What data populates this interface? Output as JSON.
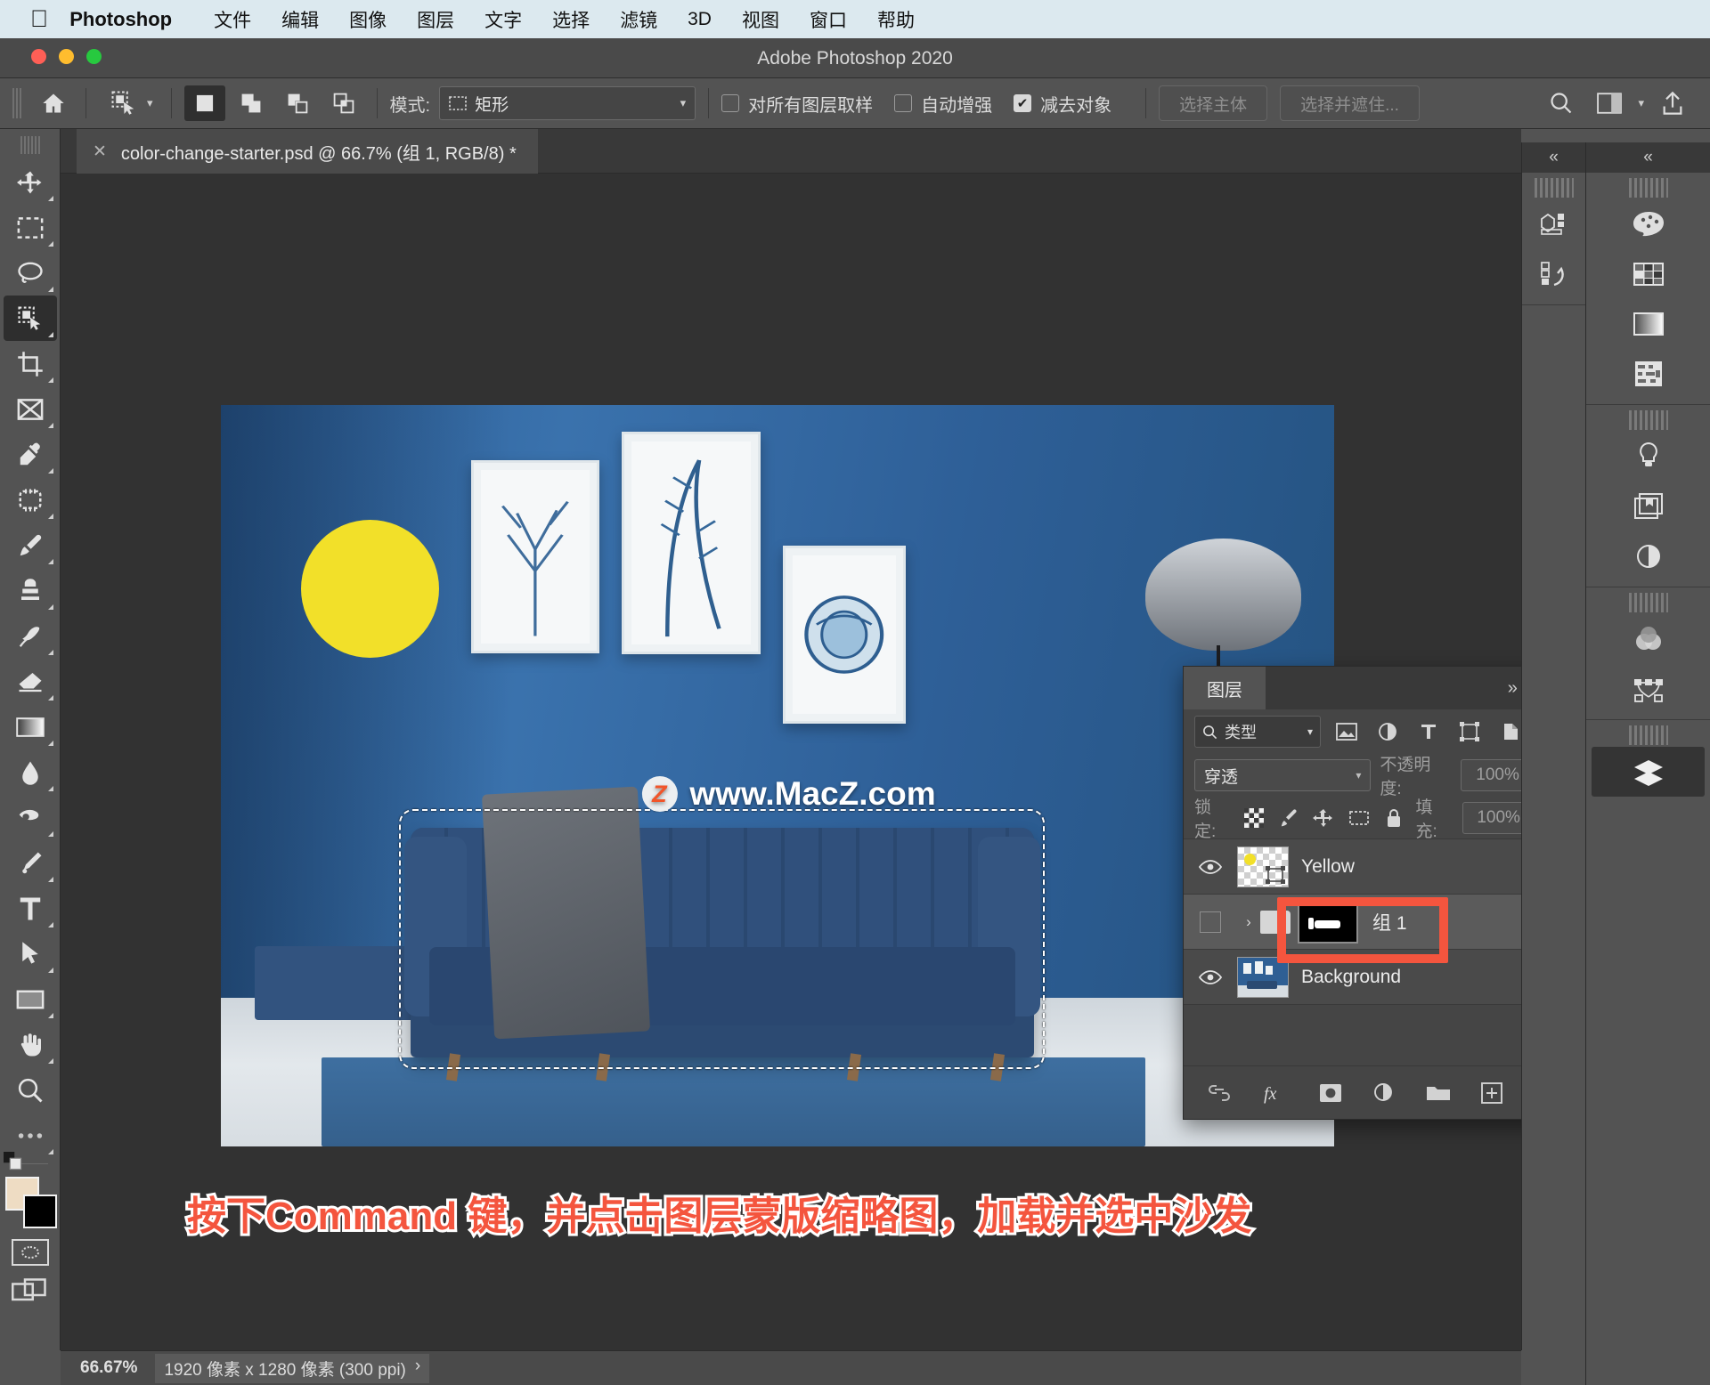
{
  "macbar": {
    "apple_icon": "apple-icon",
    "app_name": "Photoshop",
    "menus": [
      "文件",
      "编辑",
      "图像",
      "图层",
      "文字",
      "选择",
      "滤镜",
      "3D",
      "视图",
      "窗口",
      "帮助"
    ]
  },
  "titlebar": {
    "title": "Adobe Photoshop 2020"
  },
  "options": {
    "home_icon": "home-icon",
    "tool_preset_icon": "quick-selection-icon",
    "selection_modes": [
      "new-selection",
      "add-to-selection",
      "subtract-from-selection",
      "intersect-selection"
    ],
    "mode_label": "模式:",
    "mode_value": "矩形",
    "checkboxes": [
      {
        "label": "对所有图层取样",
        "checked": false
      },
      {
        "label": "自动增强",
        "checked": false
      },
      {
        "label": "减去对象",
        "checked": true
      }
    ],
    "buttons": [
      "选择主体",
      "选择并遮住..."
    ],
    "right_icons": [
      "search-icon",
      "workspace-icon",
      "chevron-down-icon",
      "share-icon"
    ]
  },
  "toolbar": {
    "tools": [
      "move-tool",
      "rectangular-marquee-tool",
      "lasso-tool",
      "quick-selection-tool",
      "crop-tool",
      "frame-tool",
      "eyedropper-tool",
      "spot-healing-brush-tool",
      "brush-tool",
      "clone-stamp-tool",
      "history-brush-tool",
      "eraser-tool",
      "gradient-tool",
      "blur-tool",
      "dodge-tool",
      "pen-tool",
      "type-tool",
      "path-selection-tool",
      "rectangle-tool",
      "hand-tool",
      "zoom-tool",
      "more-tools"
    ],
    "active_tool": "quick-selection-tool",
    "foreground_color": "#eedcc3",
    "background_color": "#000000",
    "quick-mask": "quick-mask-icon",
    "screen-mode": "screen-mode-icon"
  },
  "document": {
    "tab_title": "color-change-starter.psd @ 66.7% (组 1, RGB/8) *",
    "close_icon": "close-icon"
  },
  "canvas": {
    "watermark_badge": "Z",
    "watermark_text": "www.MacZ.com",
    "annotation": "按下Command 键，并点击图层蒙版缩略图，加载并选中沙发"
  },
  "layers_panel": {
    "tab_label": "图层",
    "expand_icon": "chevrons-right-icon",
    "menu_icon": "panel-menu-icon",
    "filter": {
      "search_icon": "search-icon",
      "value": "类型",
      "chevron": "chevron-down-icon"
    },
    "filter_icons": [
      "pixel-filter-icon",
      "adjustment-filter-icon",
      "type-filter-icon",
      "shape-filter-icon",
      "smart-object-filter-icon"
    ],
    "filter_toggle": "filter-toggle-icon",
    "blend_mode": "穿透",
    "opacity_label": "不透明度:",
    "opacity_value": "100%",
    "lock_label": "锁定:",
    "lock_icons": [
      "lock-transparent-pixels-icon",
      "lock-image-pixels-icon",
      "lock-position-icon",
      "lock-artboard-icon",
      "lock-all-icon"
    ],
    "fill_label": "填充:",
    "fill_value": "100%",
    "layers": [
      {
        "name": "Yellow",
        "visible": true,
        "type": "pixel",
        "selected": false
      },
      {
        "name": "组 1",
        "visible": false,
        "type": "group",
        "selected": true,
        "highlighted": true
      },
      {
        "name": "Background",
        "visible": true,
        "type": "image",
        "selected": false,
        "locked": true
      }
    ],
    "bottom_icons": [
      "link-layers-icon",
      "layer-style-fx-icon",
      "add-layer-mask-icon",
      "new-adjustment-layer-icon",
      "new-group-icon",
      "new-layer-icon",
      "delete-layer-icon"
    ]
  },
  "right_rails": {
    "collapse_icon": "chevrons-left-icon",
    "inner_groups": [
      {
        "icons": [
          "3d-panel-icon",
          "history-panel-icon"
        ]
      }
    ],
    "outer_groups": [
      {
        "icons": [
          "color-panel-icon",
          "swatches-panel-icon",
          "gradients-panel-icon",
          "patterns-panel-icon"
        ]
      },
      {
        "icons": [
          "adjustments-panel-icon",
          "libraries-panel-icon",
          "properties-panel-icon"
        ]
      },
      {
        "icons": [
          "channels-panel-icon",
          "paths-panel-icon"
        ]
      },
      {
        "icons": [
          "layers-panel-icon"
        ],
        "active": "layers-panel-icon"
      }
    ]
  },
  "statusbar": {
    "zoom": "66.67%",
    "dimensions": "1920 像素 x 1280 像素 (300 ppi)",
    "chevron": "chevron-right-icon"
  },
  "colors": {
    "accent_red": "#f4553e",
    "yellow_shape": "#f2e029",
    "wall_blue": "#2f5f94"
  }
}
